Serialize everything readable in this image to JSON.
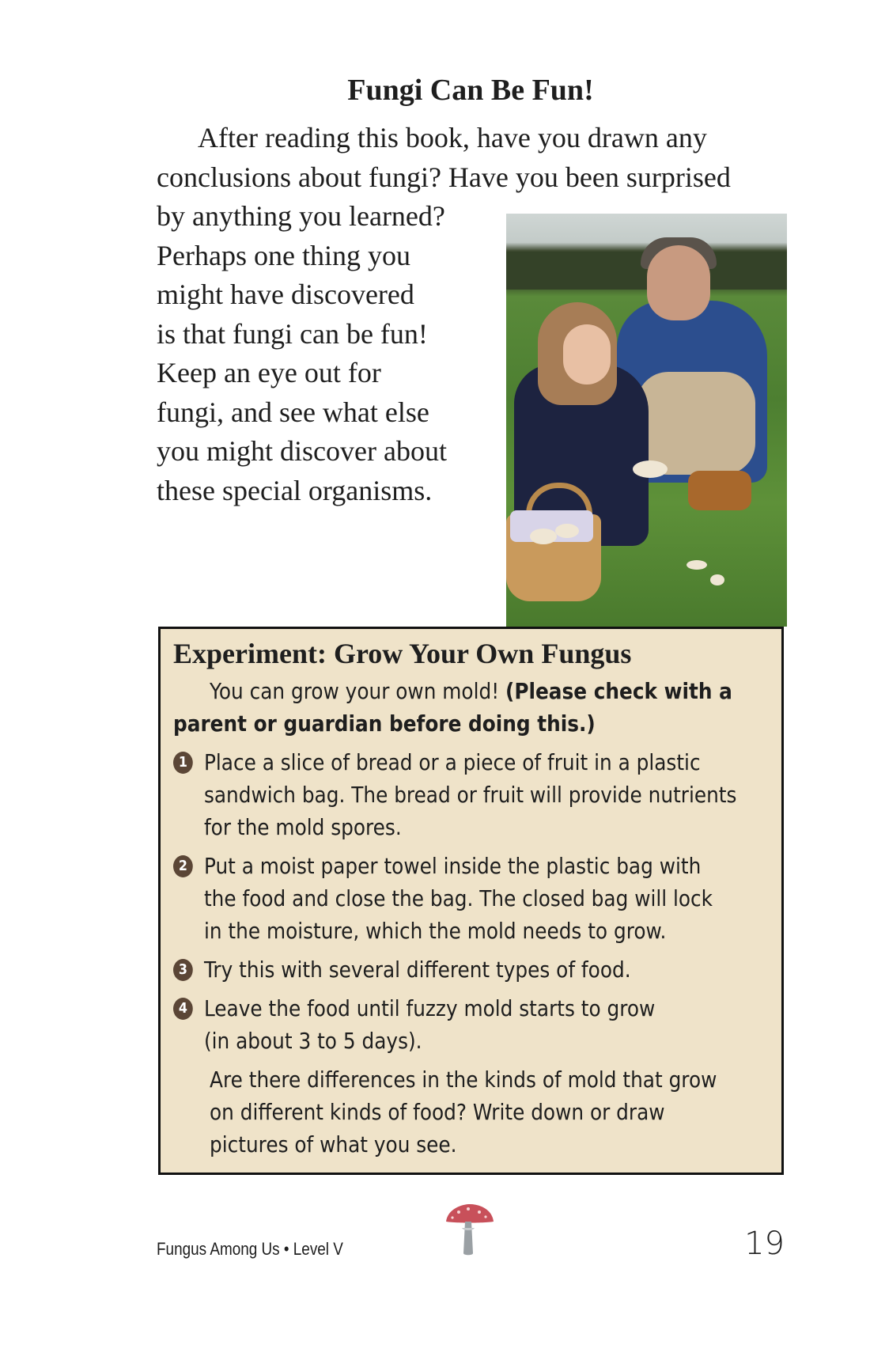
{
  "page": {
    "title": "Fungi Can Be Fun!",
    "intro_lines": [
      "After reading this book, have you drawn any",
      "conclusions about fungi? Have you been surprised",
      "by anything you learned?",
      "Perhaps one thing you",
      "might have discovered",
      "is that fungi can be fun!",
      "Keep an eye out for",
      "fungi, and see what else",
      "you might discover about",
      "these special organisms."
    ]
  },
  "experiment": {
    "title": "Experiment: Grow Your Own Fungus",
    "intro_plain": "You can grow your own mold! ",
    "intro_bold_1": "(Please check with a",
    "intro_bold_2": "parent or guardian before doing this.)",
    "steps": [
      {
        "number": "1",
        "lines": [
          "Place a slice of bread or a piece of fruit in a plastic",
          "sandwich bag. The bread or fruit will provide nutrients",
          "for the mold spores."
        ]
      },
      {
        "number": "2",
        "lines": [
          "Put a moist paper towel inside the plastic bag with",
          "the food and close the bag. The closed bag will lock",
          "in the moisture, which the mold needs to grow."
        ]
      },
      {
        "number": "3",
        "lines": [
          "Try this with several different types of food."
        ]
      },
      {
        "number": "4",
        "lines": [
          "Leave the food until fuzzy mold starts to grow",
          "(in about 3 to 5 days)."
        ]
      }
    ],
    "outro_lines": [
      "Are there differences in the kinds of mold that grow",
      "on different kinds of food? Write down or draw",
      "pictures of what you see."
    ]
  },
  "footer": {
    "book_label": "Fungus Among Us • Level V",
    "page_number": "19",
    "icon": "mushroom-icon"
  }
}
